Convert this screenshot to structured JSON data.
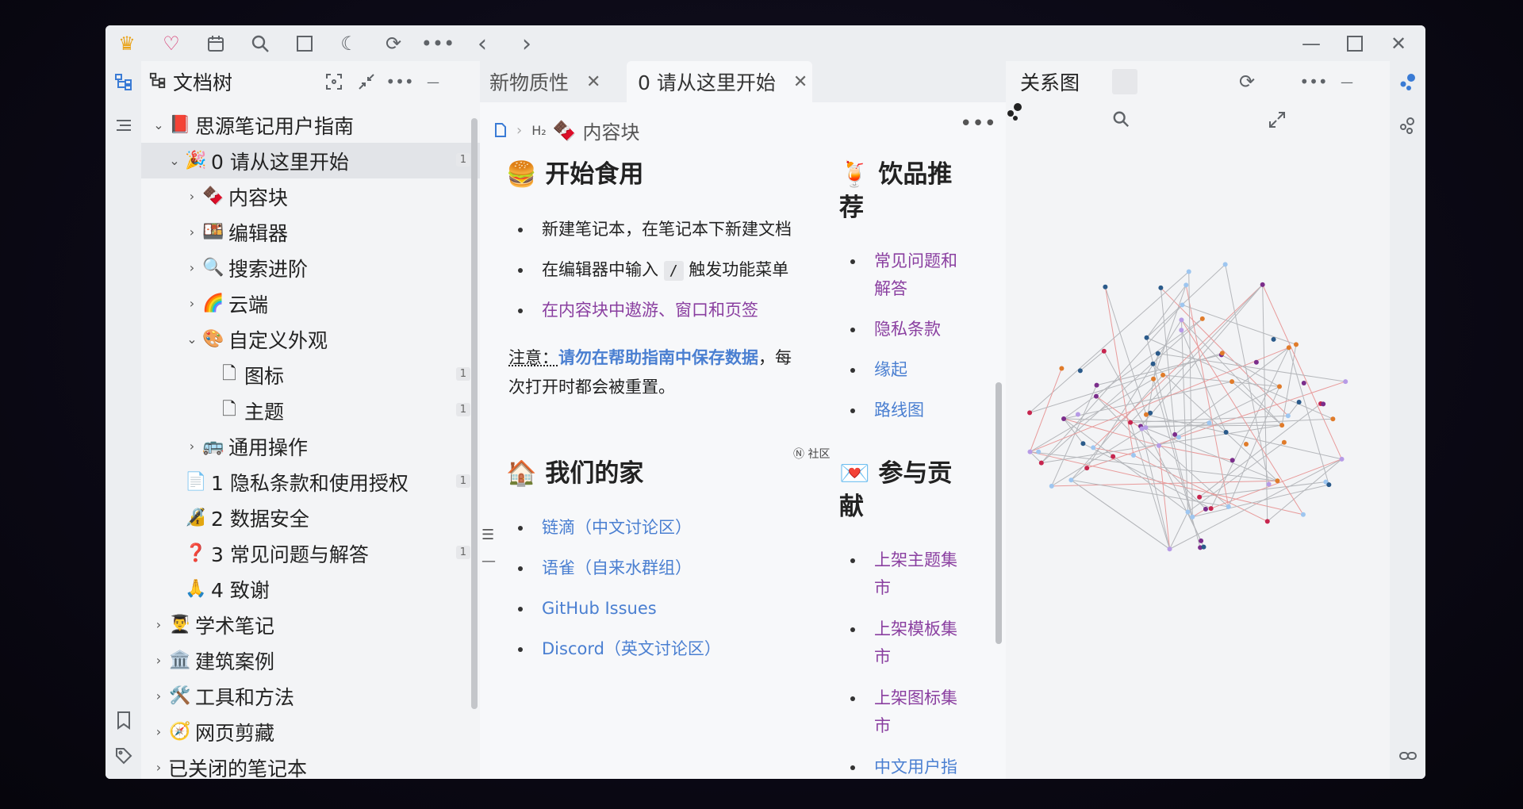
{
  "toolbar": {
    "icons": [
      "crown-icon",
      "heart-icon",
      "calendar-icon",
      "search-icon",
      "square-icon",
      "moon-icon",
      "sync-icon",
      "more-icon",
      "back-icon",
      "forward-icon"
    ],
    "window_controls": [
      "minimize-icon",
      "maximize-icon",
      "close-icon"
    ]
  },
  "filetree": {
    "title": "文档树",
    "rows": [
      {
        "label": "思源笔记用户指南",
        "emoji": "📕",
        "depth": 0,
        "expanded": true
      },
      {
        "label": "0 请从这里开始",
        "emoji": "🎉",
        "depth": 1,
        "expanded": true,
        "count": "1",
        "active": true
      },
      {
        "label": "内容块",
        "emoji": "🍫",
        "depth": 2
      },
      {
        "label": "编辑器",
        "emoji": "🍱",
        "depth": 2
      },
      {
        "label": "搜索进阶",
        "emoji": "🔍",
        "depth": 2
      },
      {
        "label": "云端",
        "emoji": "🌈",
        "depth": 2
      },
      {
        "label": "自定义外观",
        "emoji": "🎨",
        "depth": 2,
        "expanded": true
      },
      {
        "label": "图标",
        "emoji": "🗋",
        "depth": 3,
        "count": "1"
      },
      {
        "label": "主题",
        "emoji": "🗋",
        "depth": 3,
        "count": "1"
      },
      {
        "label": "通用操作",
        "emoji": "🚌",
        "depth": 2
      },
      {
        "label": "1 隐私条款和使用授权",
        "emoji": "📄",
        "depth": 1,
        "count": "1"
      },
      {
        "label": "2 数据安全",
        "emoji": "🔏",
        "depth": 1
      },
      {
        "label": "3 常见问题与解答",
        "emoji": "❓",
        "depth": 1,
        "count": "1"
      },
      {
        "label": "4 致谢",
        "emoji": "🙏",
        "depth": 1
      },
      {
        "label": "学术笔记",
        "emoji": "👨‍🎓",
        "depth": 0
      },
      {
        "label": "建筑案例",
        "emoji": "🏛️",
        "depth": 0
      },
      {
        "label": "工具和方法",
        "emoji": "🛠️",
        "depth": 0
      },
      {
        "label": "网页剪藏",
        "emoji": "🧭",
        "depth": 0
      },
      {
        "label": "已关闭的笔记本",
        "emoji": "",
        "depth": 0
      }
    ]
  },
  "tabs": [
    {
      "label": "新物质性",
      "close": "✕"
    },
    {
      "label": "0 请从这里开始",
      "close": "✕"
    }
  ],
  "editor": {
    "breadcrumb": {
      "heading": "H₂",
      "emoji": "🍫",
      "label": "内容块"
    },
    "sec1": {
      "emoji": "🍔",
      "title": "开始食用"
    },
    "sec1_items": [
      "新建笔记本，在笔记本下新建文档",
      "在编辑器中输入",
      "触发功能菜单",
      "在内容块中遨游、窗口和页签"
    ],
    "slash": "/",
    "note": {
      "prefix": "注意：",
      "link": "请勿在帮助指南中保存数据",
      "suffix": "，每",
      "line2": "次打开时都会被重置。"
    },
    "community": "Ⓝ 社区",
    "sec2": {
      "emoji": "🏠",
      "title": "我们的家"
    },
    "sec2_items": [
      "链滴（中文讨论区）",
      "语雀（自来水群组）",
      "GitHub Issues",
      "Discord（英文讨论区）"
    ],
    "sec3": {
      "emoji": "🍹",
      "title_l1": "饮品推",
      "title_l2": "荐"
    },
    "sec3_items": [
      [
        "常见问题和",
        "解答"
      ],
      [
        "隐私条款"
      ],
      [
        "缘起"
      ],
      [
        "路线图"
      ]
    ],
    "sec4": {
      "emoji": "💌",
      "title_l1": "参与贡",
      "title_l2": "献"
    },
    "sec4_items": [
      [
        "上架主题集",
        "市"
      ],
      [
        "上架模板集",
        "市"
      ],
      [
        "上架图标集",
        "市"
      ],
      [
        "中文用户指"
      ]
    ]
  },
  "graph": {
    "title": "关系图",
    "colors": {
      "purple": "#7b2d8b",
      "blue": "#2a5a8a",
      "orange": "#e07b2a",
      "light": "#9ec6f0",
      "red": "#c7254e",
      "lilac": "#b79be6"
    }
  }
}
